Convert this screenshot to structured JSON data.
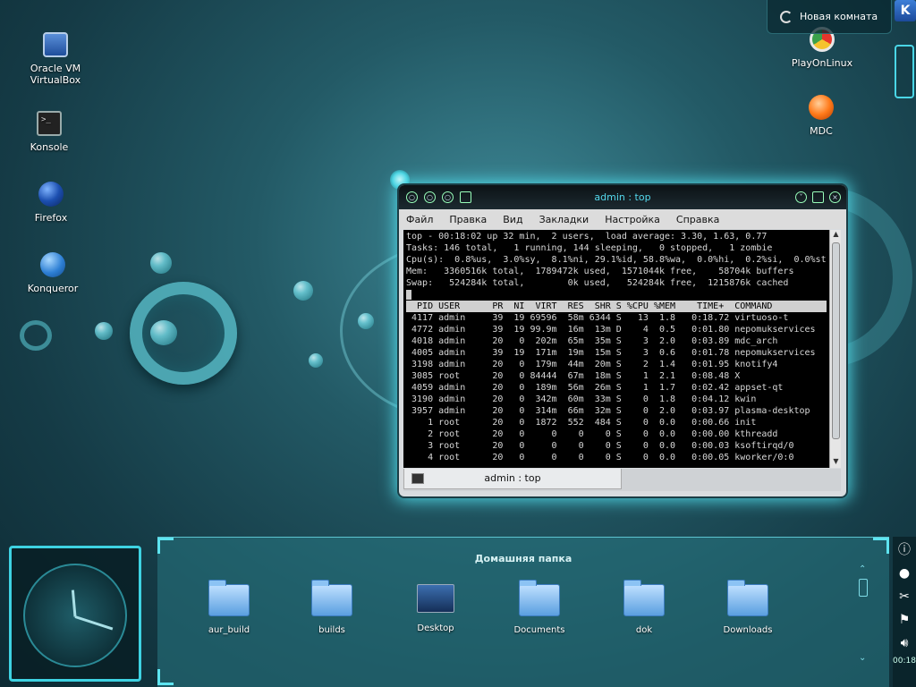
{
  "desktop_icons": {
    "virtualbox": "Oracle VM VirtualBox",
    "konsole": "Konsole",
    "firefox": "Firefox",
    "konqueror": "Konqueror",
    "playonlinux": "PlayOnLinux",
    "mdc": "MDC"
  },
  "activity": {
    "label": "Новая комната"
  },
  "window": {
    "title": "admin : top",
    "menu": [
      "Файл",
      "Правка",
      "Вид",
      "Закладки",
      "Настройка",
      "Справка"
    ],
    "tab_label": "admin : top"
  },
  "terminal": {
    "summary": [
      "top - 00:18:02 up 32 min,  2 users,  load average: 3.30, 1.63, 0.77",
      "Tasks: 146 total,   1 running, 144 sleeping,   0 stopped,   1 zombie",
      "Cpu(s):  0.8%us,  3.0%sy,  8.1%ni, 29.1%id, 58.8%wa,  0.0%hi,  0.2%si,  0.0%st",
      "Mem:   3360516k total,  1789472k used,  1571044k free,    58704k buffers",
      "Swap:   524284k total,        0k used,   524284k free,  1215876k cached"
    ],
    "header": "  PID USER      PR  NI  VIRT  RES  SHR S %CPU %MEM    TIME+  COMMAND",
    "rows": [
      " 4117 admin     39  19 69596  58m 6344 S   13  1.8   0:18.72 virtuoso-t",
      " 4772 admin     39  19 99.9m  16m  13m D    4  0.5   0:01.80 nepomukservices",
      " 4018 admin     20   0  202m  65m  35m S    3  2.0   0:03.89 mdc_arch",
      " 4005 admin     39  19  171m  19m  15m S    3  0.6   0:01.78 nepomukservices",
      " 3198 admin     20   0  179m  44m  20m S    2  1.4   0:01.95 knotify4",
      " 3085 root      20   0 84444  67m  18m S    1  2.1   0:08.48 X",
      " 4059 admin     20   0  189m  56m  26m S    1  1.7   0:02.42 appset-qt",
      " 3190 admin     20   0  342m  60m  33m S    0  1.8   0:04.12 kwin",
      " 3957 admin     20   0  314m  66m  32m S    0  2.0   0:03.97 plasma-desktop",
      "    1 root      20   0  1872  552  484 S    0  0.0   0:00.66 init",
      "    2 root      20   0     0    0    0 S    0  0.0   0:00.00 kthreadd",
      "    3 root      20   0     0    0    0 S    0  0.0   0:00.03 ksoftirqd/0",
      "    4 root      20   0     0    0    0 S    0  0.0   0:00.05 kworker/0:0"
    ]
  },
  "folderview": {
    "title": "Домашняя папка",
    "items": [
      "aur_build",
      "builds",
      "Desktop",
      "Documents",
      "dok",
      "Downloads"
    ]
  },
  "tray": {
    "clock": "00:18"
  },
  "colors": {
    "accent": "#4fd6e4",
    "title_text": "#54d8ec"
  }
}
